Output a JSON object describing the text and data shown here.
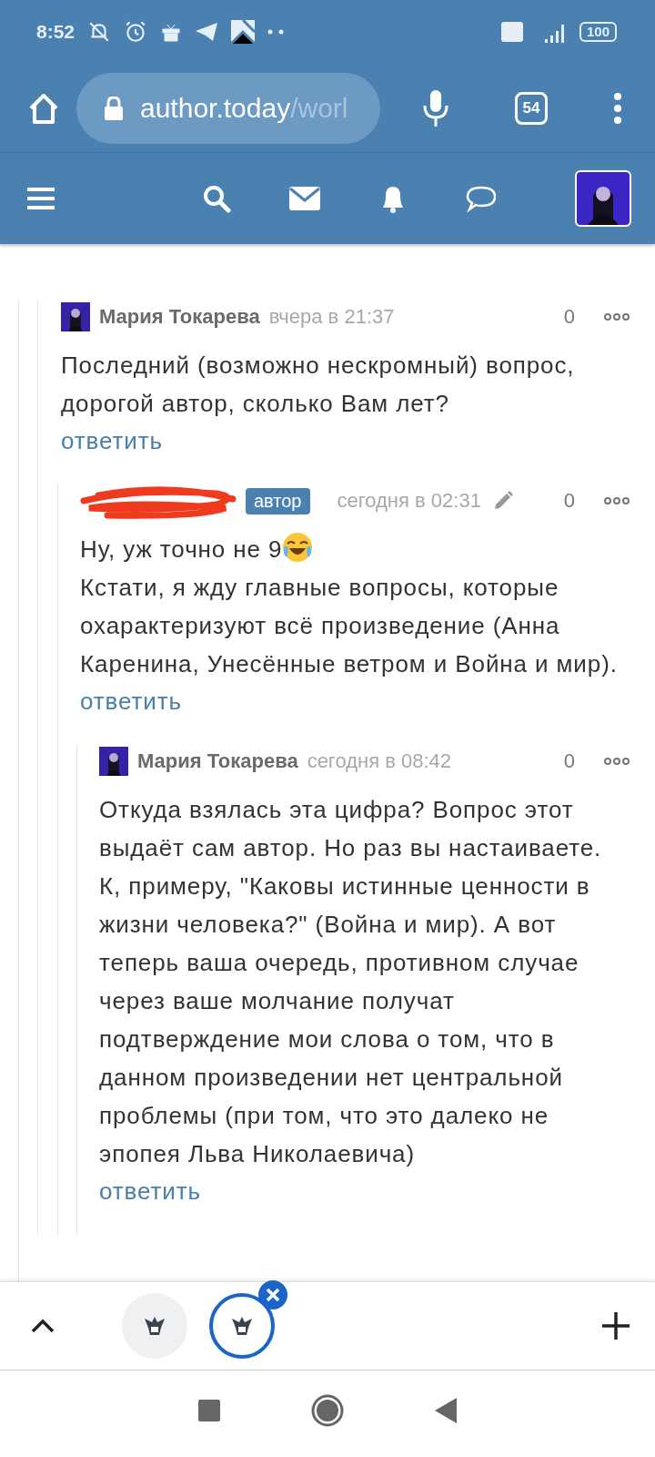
{
  "status_bar": {
    "time": "8:52",
    "battery": "100"
  },
  "browser": {
    "url_host": "author.today",
    "url_path": "/worl",
    "tab_count": "54"
  },
  "comments": [
    {
      "author": "Мария Токарева",
      "author_redacted": false,
      "time": "вчера в 21:37",
      "edited": false,
      "score": "0",
      "paragraphs": [
        "Последний (возможно нескромный) вопрос, дорогой автор, сколько Вам лет?"
      ],
      "emoji_after_first": false,
      "reply": "ответить",
      "children": [
        {
          "author_redacted": true,
          "badge": "автор",
          "time": "сегодня в 02:31",
          "edited": true,
          "score": "0",
          "paragraphs": [
            "Ну, уж точно не 9",
            "Кстати, я  жду главные вопросы, которые охарактеризуют всё произведение (Анна Каренина, Унесённые ветром и Война и мир)."
          ],
          "emoji_after_first": true,
          "reply": "ответить",
          "children": [
            {
              "author": "Мария Токарева",
              "author_redacted": false,
              "time": "сегодня в 08:42",
              "edited": false,
              "score": "0",
              "paragraphs": [
                "Откуда взялась эта цифра? Вопрос этот выдаёт сам автор. Но раз вы настаиваете. К, примеру, \"Каковы истинные ценности в жизни человека?\" (Война и мир). А вот теперь ваша очередь, противном случае через ваше молчание получат подтверждение мои слова о том, что в данном произведении нет центральной проблемы (при том, что это далеко не эпопея Льва Николаевича)"
              ],
              "emoji_after_first": false,
              "reply": "ответить"
            }
          ]
        }
      ]
    }
  ],
  "open_tabs": [
    {
      "selected": false
    },
    {
      "selected": true
    }
  ]
}
